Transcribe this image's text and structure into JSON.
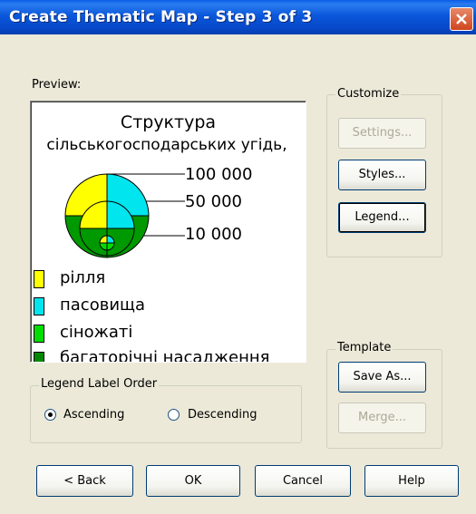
{
  "window": {
    "title": "Create Thematic Map - Step 3 of 3"
  },
  "preview": {
    "label": "Preview:",
    "legend_title": "Структура",
    "legend_subtitle": "сільськогосподарських угідь,",
    "sizes": [
      "100 000",
      "50 000",
      "10 000"
    ],
    "categories": [
      {
        "label": "рілля",
        "color": "#ffff00"
      },
      {
        "label": "пасовища",
        "color": "#00e5ee"
      },
      {
        "label": "сіножаті",
        "color": "#00dd00"
      },
      {
        "label": "багаторічні насадження",
        "color": "#008800"
      }
    ],
    "pie_colors": {
      "yellow": "#ffff00",
      "cyan": "#00e5ee",
      "green": "#009900",
      "light_green": "#00dd00"
    }
  },
  "customize": {
    "group_label": "Customize",
    "settings_label": "Settings...",
    "styles_label": "Styles...",
    "legend_label": "Legend..."
  },
  "template": {
    "group_label": "Template",
    "save_as_label": "Save As...",
    "merge_label": "Merge..."
  },
  "legend_order": {
    "group_label": "Legend Label Order",
    "ascending_label": "Ascending",
    "descending_label": "Descending",
    "selected": "Ascending"
  },
  "footer": {
    "back_label": "< Back",
    "ok_label": "OK",
    "cancel_label": "Cancel",
    "help_label": "Help"
  }
}
